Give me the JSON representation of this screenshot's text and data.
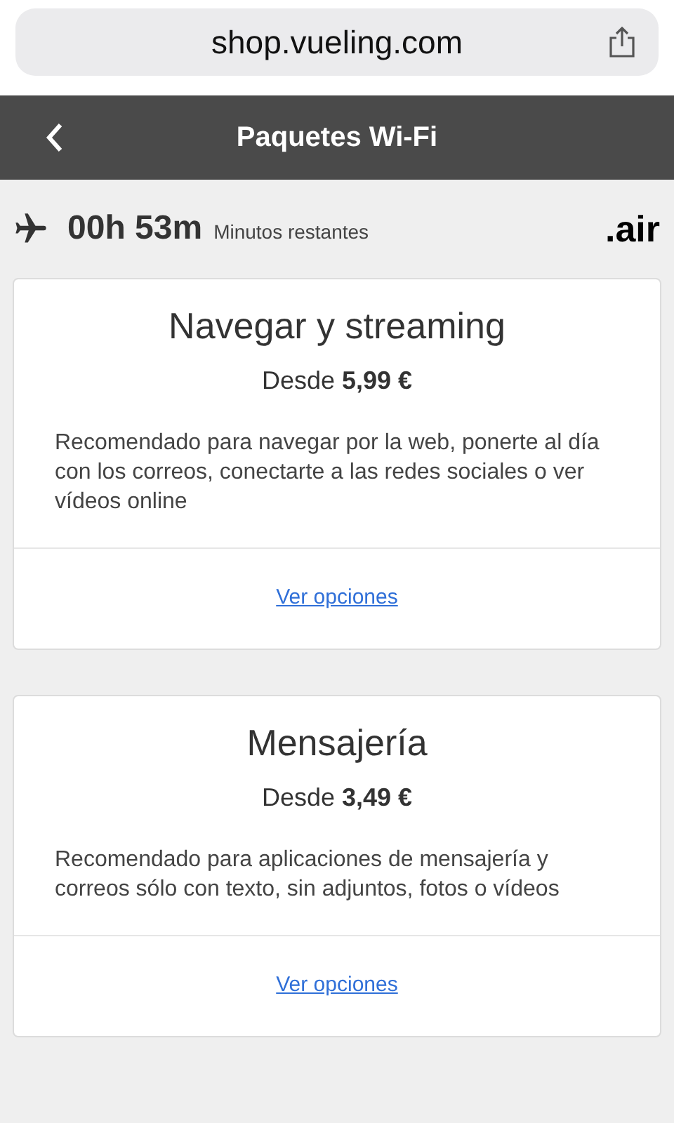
{
  "browser": {
    "url": "shop.vueling.com"
  },
  "header": {
    "title": "Paquetes Wi-Fi"
  },
  "flight": {
    "time": "00h 53m",
    "time_label": "Minutos restantes",
    "brand": ".air"
  },
  "packages": [
    {
      "title": "Navegar y streaming",
      "price": "Desde **5,99 €**",
      "description": "Recomendado para navegar por la web, ponerte al día con los correos, conectarte a las redes sociales o ver vídeos online",
      "link": "Ver opciones"
    },
    {
      "title": "Mensajería",
      "price": "Desde **3,49 €**",
      "description": "Recomendado para aplicaciones de mensajería y correos sólo con texto, sin adjuntos, fotos o vídeos",
      "link": "Ver opciones"
    }
  ]
}
